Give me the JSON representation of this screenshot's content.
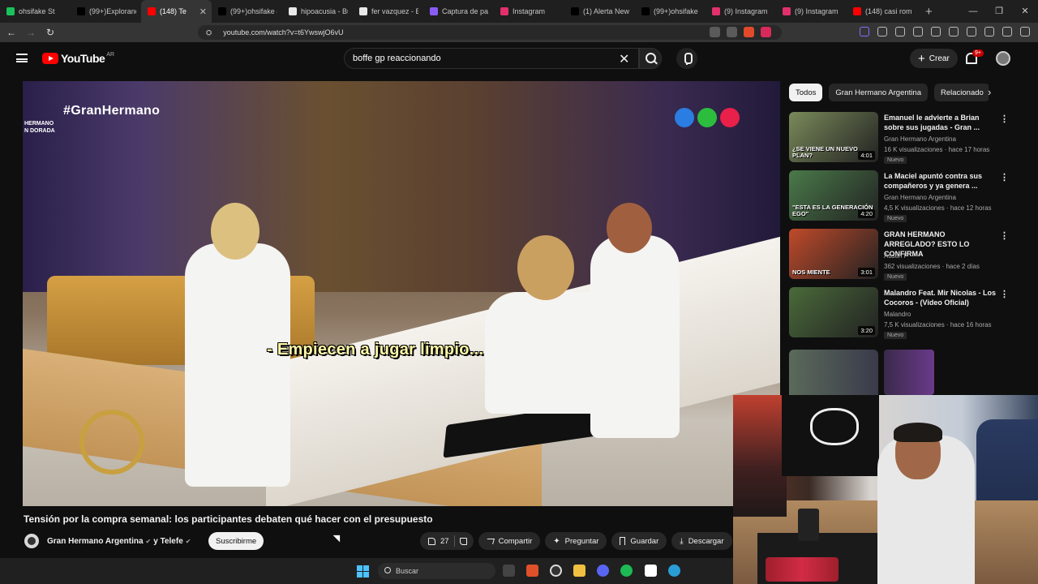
{
  "browser": {
    "tabs": [
      {
        "label": "ohsifake St",
        "favicon_color": "#19c25a",
        "active": false
      },
      {
        "label": "(99+)Explorando",
        "favicon_color": "#000000",
        "active": false
      },
      {
        "label": "(148) Te",
        "favicon_color": "#ff0000",
        "active": true
      },
      {
        "label": "(99+)ohsifake (",
        "favicon_color": "#000000",
        "active": false
      },
      {
        "label": "hipoacusia - Bu",
        "favicon_color": "#e8e8e8",
        "active": false
      },
      {
        "label": "fer vazquez - B",
        "favicon_color": "#e8e8e8",
        "active": false
      },
      {
        "label": "Captura de pa",
        "favicon_color": "#8a5cf6",
        "active": false
      },
      {
        "label": "Instagram",
        "favicon_color": "#e1306c",
        "active": false
      },
      {
        "label": "(1) Alerta New",
        "favicon_color": "#000000",
        "active": false
      },
      {
        "label": "(99+)ohsifake",
        "favicon_color": "#000000",
        "active": false
      },
      {
        "label": "(9) Instagram",
        "favicon_color": "#e1306c",
        "active": false
      },
      {
        "label": "(9) Instagram",
        "favicon_color": "#e1306c",
        "active": false
      },
      {
        "label": "(148) casi romp",
        "favicon_color": "#ff0000",
        "active": false
      }
    ],
    "url": "youtube.com/watch?v=t6YwswjO6vU"
  },
  "youtube": {
    "logo_text": "YouTube",
    "country_code": "AR",
    "search_query": "boffe gp reaccionando",
    "create_label": "Crear",
    "notifications_badge": "9+"
  },
  "video": {
    "hashtag": "#GranHermano",
    "logo_lines": [
      "HERMANO",
      "N DORADA"
    ],
    "subtitle": "- Empiecen a jugar limpio...",
    "title": "Tensión por la compra semanal: los participantes debaten qué hacer con el presupuesto",
    "channel": "Gran Hermano Argentina",
    "collab_channel": "y Telefe",
    "subscribe_label": "Suscribirme",
    "likes": "27",
    "actions": {
      "share": "Compartir",
      "ask": "Preguntar",
      "save": "Guardar",
      "download": "Descargar"
    },
    "logo_dot_colors": [
      "#2a7de1",
      "#2cbc3e",
      "#e8204a"
    ]
  },
  "sidebar": {
    "chips": [
      "Todos",
      "Gran Hermano Argentina",
      "Relacionado"
    ],
    "recommendations": [
      {
        "title": "Emanuel le advierte a Brian sobre sus jugadas - Gran ...",
        "channel": "Gran Hermano Argentina",
        "meta": "16 K visualizaciones · hace 17 horas",
        "badge": "Nuevo",
        "duration": "4:01",
        "thumb_caption": "¿SE VIENE UN NUEVO PLAN?",
        "thumb_color": "#7a8a5a"
      },
      {
        "title": "La Maciel apuntó contra sus compañeros y ya genera ...",
        "channel": "Gran Hermano Argentina",
        "meta": "4,5 K visualizaciones · hace 12 horas",
        "badge": "Nuevo",
        "duration": "4:20",
        "thumb_caption": "\"ESTA ES LA GENERACIÓN EGO\"",
        "thumb_color": "#4a7a4a"
      },
      {
        "title": "GRAN HERMANO ARREGLADO? ESTO LO CONFIRMA",
        "channel": "Austin P",
        "meta": "362 visualizaciones · hace 2 días",
        "badge": "Nuevo",
        "duration": "3:01",
        "thumb_caption": "NOS MIENTE",
        "thumb_color": "#c04a2a"
      },
      {
        "title": "Malandro Feat. Mir Nicolas - Los Cocoros - (Video Oficial)",
        "channel": "Malandro",
        "meta": "7,5 K visualizaciones · hace 16 horas",
        "badge": "Nuevo",
        "duration": "3:20",
        "thumb_caption": "",
        "thumb_color": "#4a6a3a"
      }
    ]
  },
  "taskbar": {
    "search_placeholder": "Buscar"
  }
}
